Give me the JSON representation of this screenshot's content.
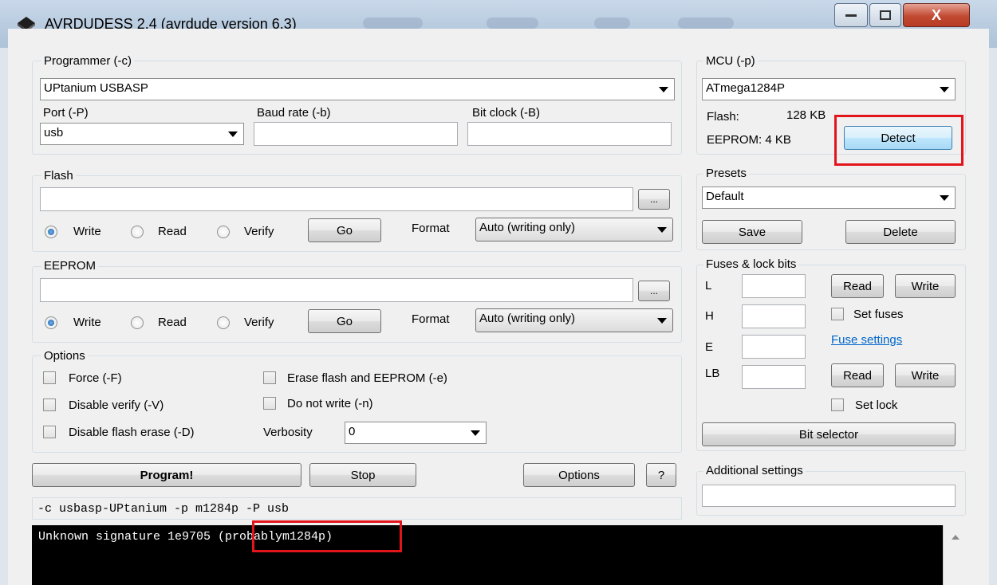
{
  "window": {
    "title": "AVRDUDESS 2.4 (avrdude version 6.3)",
    "minimize_icon": "minimize-icon",
    "maximize_icon": "maximize-icon",
    "close_label": "X"
  },
  "programmer": {
    "group_label": "Programmer (-c)",
    "selected": "UPtanium USBASP",
    "port_label": "Port (-P)",
    "port_value": "usb",
    "baud_label": "Baud rate (-b)",
    "baud_value": "",
    "bitclock_label": "Bit clock (-B)",
    "bitclock_value": ""
  },
  "mcu": {
    "group_label": "MCU (-p)",
    "selected": "ATmega1284P",
    "flash_label": "Flash:",
    "flash_value": "128 KB",
    "eeprom_label": "EEPROM: 4 KB",
    "detect_label": "Detect"
  },
  "flash": {
    "group_label": "Flash",
    "file_value": "",
    "browse_label": "...",
    "write_label": "Write",
    "read_label": "Read",
    "verify_label": "Verify",
    "go_label": "Go",
    "format_label": "Format",
    "format_value": "Auto (writing only)",
    "selected_mode": "Write"
  },
  "eeprom": {
    "group_label": "EEPROM",
    "file_value": "",
    "browse_label": "...",
    "write_label": "Write",
    "read_label": "Read",
    "verify_label": "Verify",
    "go_label": "Go",
    "format_label": "Format",
    "format_value": "Auto (writing only)",
    "selected_mode": "Write"
  },
  "presets": {
    "group_label": "Presets",
    "selected": "Default",
    "save_label": "Save",
    "delete_label": "Delete"
  },
  "fuses": {
    "group_label": "Fuses & lock bits",
    "l_label": "L",
    "h_label": "H",
    "e_label": "E",
    "lb_label": "LB",
    "read_label": "Read",
    "write_label": "Write",
    "set_fuses_label": "Set fuses",
    "fuse_settings_link": "Fuse settings",
    "set_lock_label": "Set lock",
    "bit_selector_label": "Bit selector"
  },
  "options": {
    "group_label": "Options",
    "force_label": "Force (-F)",
    "disable_verify_label": "Disable verify (-V)",
    "disable_flash_erase_label": "Disable flash erase (-D)",
    "erase_label": "Erase flash and EEPROM (-e)",
    "do_not_write_label": "Do not write (-n)",
    "verbosity_label": "Verbosity",
    "verbosity_value": "0"
  },
  "actions": {
    "program_label": "Program!",
    "stop_label": "Stop",
    "options_label": "Options",
    "help_label": "?"
  },
  "additional": {
    "group_label": "Additional settings",
    "value": ""
  },
  "cmdline": "-c usbasp-UPtanium -p m1284p -P usb",
  "console": {
    "line1": "Unknown signature 1e9705 (probablym1284p)"
  },
  "colors": {
    "highlight": "#e3151c",
    "link": "#0066cc",
    "console_bg": "#000000"
  }
}
